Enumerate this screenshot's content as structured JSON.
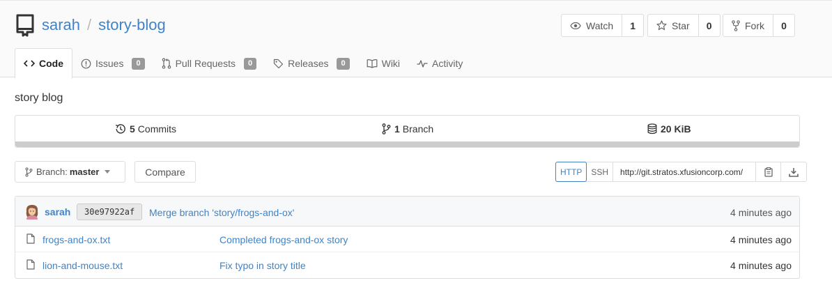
{
  "repo": {
    "owner": "sarah",
    "separator": "/",
    "name": "story-blog",
    "description": "story blog"
  },
  "actions": {
    "watch": {
      "label": "Watch",
      "count": "1"
    },
    "star": {
      "label": "Star",
      "count": "0"
    },
    "fork": {
      "label": "Fork",
      "count": "0"
    }
  },
  "tabs": [
    {
      "label": "Code",
      "icon": "code-icon",
      "active": true
    },
    {
      "label": "Issues",
      "icon": "issue-icon",
      "badge": "0"
    },
    {
      "label": "Pull Requests",
      "icon": "pull-request-icon",
      "badge": "0"
    },
    {
      "label": "Releases",
      "icon": "tag-icon",
      "badge": "0"
    },
    {
      "label": "Wiki",
      "icon": "book-icon"
    },
    {
      "label": "Activity",
      "icon": "pulse-icon"
    }
  ],
  "stats": {
    "commits": {
      "count": "5",
      "label": "Commits"
    },
    "branches": {
      "count": "1",
      "label": "Branch"
    },
    "size": {
      "value": "20 KiB"
    }
  },
  "branch": {
    "prefix": "Branch:",
    "name": "master"
  },
  "compare_label": "Compare",
  "clone": {
    "http_label": "HTTP",
    "ssh_label": "SSH",
    "url": "http://git.stratos.xfusioncorp.com/"
  },
  "latest_commit": {
    "author": "sarah",
    "sha": "30e97922af",
    "message": "Merge branch 'story/frogs-and-ox'",
    "time": "4 minutes ago"
  },
  "files": [
    {
      "name": "frogs-and-ox.txt",
      "message": "Completed frogs-and-ox story",
      "time": "4 minutes ago"
    },
    {
      "name": "lion-and-mouse.txt",
      "message": "Fix typo in story title",
      "time": "4 minutes ago"
    }
  ],
  "colors": {
    "link": "#4183c4",
    "badge": "#999999",
    "border": "#dddddd"
  }
}
